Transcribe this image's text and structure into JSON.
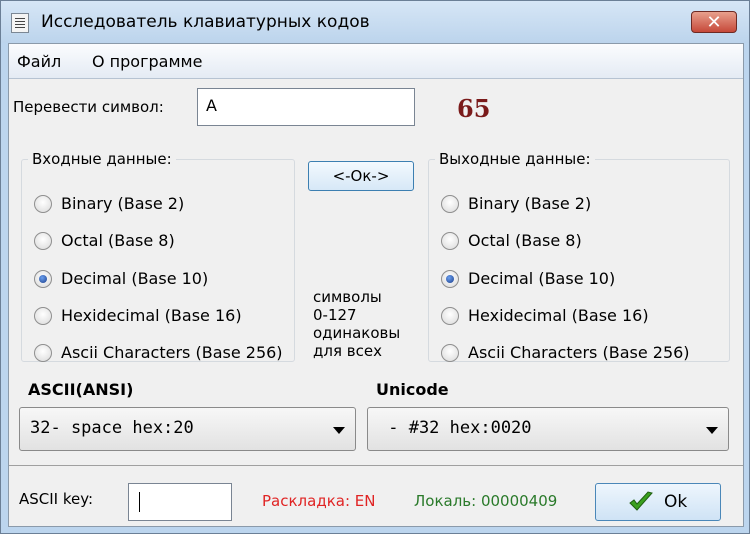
{
  "window": {
    "title": "Исследователь клавиатурных кодов",
    "close_glyph": "✕",
    "icon": "app-document-icon"
  },
  "menu": {
    "file": "Файл",
    "about": "О программе"
  },
  "translate": {
    "label": "Перевести символ:",
    "value": "A",
    "code": "65"
  },
  "input_group": {
    "legend": "Входные данные:",
    "options": [
      "Binary (Base 2)",
      "Octal (Base 8)",
      "Decimal (Base 10)",
      "Hexidecimal (Base 16)",
      "Ascii Characters (Base 256)"
    ],
    "selected": "Decimal (Base 10)"
  },
  "output_group": {
    "legend": "Выходные данные:",
    "options": [
      "Binary (Base 2)",
      "Octal (Base 8)",
      "Decimal (Base 10)",
      "Hexidecimal (Base 16)",
      "Ascii Characters (Base 256)"
    ],
    "selected": "Decimal (Base 10)"
  },
  "center_button": "<-Ок->",
  "note": [
    "символы",
    "0-127",
    "одинаковы",
    "для всех"
  ],
  "ascii": {
    "label": "ASCII(ANSI)",
    "value": "32- space hex:20"
  },
  "unicode": {
    "label": "Unicode",
    "value": " - #32 hex:0020"
  },
  "bottom": {
    "ascii_key_label": "ASCII key:",
    "ascii_key_value": "",
    "layout": "Раскладка: EN",
    "locale": "Локаль: 00000409",
    "ok_label": "Ok",
    "ok_icon": "checkmark-icon"
  },
  "colors": {
    "code": "#7a1a1a",
    "layout": "#e02424",
    "locale": "#2a7a2a",
    "checkmark": "#3aa01e"
  }
}
